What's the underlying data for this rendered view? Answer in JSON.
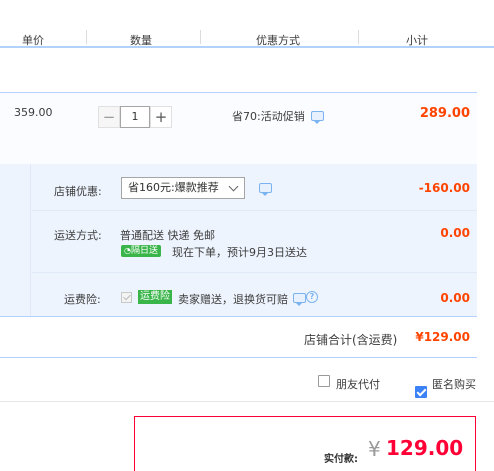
{
  "header": {
    "col_unit_price": "单价",
    "col_quantity": "数量",
    "col_discount": "优惠方式",
    "col_subtotal": "小计"
  },
  "item": {
    "unit_price": "359.00",
    "quantity": "1",
    "minus": "−",
    "plus": "+",
    "promotion": "省70:活动促销",
    "subtotal": "289.00"
  },
  "shop": {
    "coupon_label": "店铺优惠:",
    "coupon_selected": "省160元:爆款推荐",
    "coupon_value": "-160.00",
    "shipping_label": "运送方式:",
    "shipping_method": "普通配送 快递 免邮",
    "shipping_badge": "隔日送",
    "shipping_note": "现在下单，预计9月3日送达",
    "shipping_value": "0.00",
    "insurance_label": "运费险:",
    "insurance_badge": "运费险",
    "insurance_text": "卖家赠送，退换货可赔",
    "insurance_help": "?",
    "insurance_value": "0.00",
    "total_label": "店铺合计(含运费)",
    "total_value": "¥129.00"
  },
  "options": {
    "friend_pay": "朋友代付",
    "anonymous": "匿名购买"
  },
  "payment": {
    "label": "实付款:",
    "currency": "¥",
    "amount": "129.00"
  },
  "colors": {
    "accent_red": "#ff0036",
    "price_orange": "#f40",
    "light_blue_bg": "#eef4fe",
    "border_blue": "#b2d1ff"
  }
}
